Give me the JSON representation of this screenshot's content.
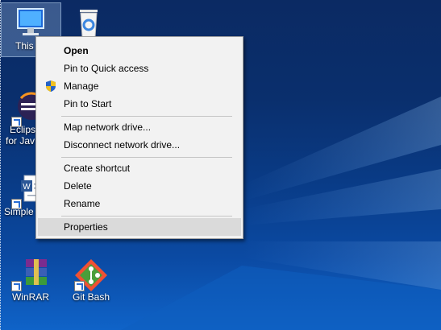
{
  "desktop": {
    "icons": [
      {
        "label": "This PC",
        "label_visible": "This",
        "icon": "computer-icon",
        "selected": true
      },
      {
        "label": "Recycle Bin",
        "icon": "recycle-bin-icon"
      },
      {
        "label_line1": "Eclipse",
        "label_line2": "for Java",
        "label_visible_line1": "Eclips",
        "label_visible_line2": "for Jav",
        "icon": "eclipse-icon"
      },
      {
        "label": "Simple",
        "icon": "word-document-icon"
      },
      {
        "label": "WinRAR",
        "icon": "winrar-icon"
      },
      {
        "label": "Git Bash",
        "icon": "git-bash-icon"
      }
    ]
  },
  "context_menu": {
    "items": [
      {
        "label": "Open",
        "bold": true
      },
      {
        "label": "Pin to Quick access"
      },
      {
        "label": "Manage",
        "icon": "uac-shield-icon"
      },
      {
        "label": "Pin to Start"
      },
      {
        "label": "Map network drive..."
      },
      {
        "label": "Disconnect network drive..."
      },
      {
        "label": "Create shortcut"
      },
      {
        "label": "Delete"
      },
      {
        "label": "Rename"
      },
      {
        "label": "Properties",
        "highlighted": true
      }
    ]
  },
  "colors": {
    "menu_bg": "#f2f2f2",
    "menu_hover": "#dadada",
    "desktop_dark": "#0b2a63",
    "desktop_light": "#0f63c8"
  }
}
